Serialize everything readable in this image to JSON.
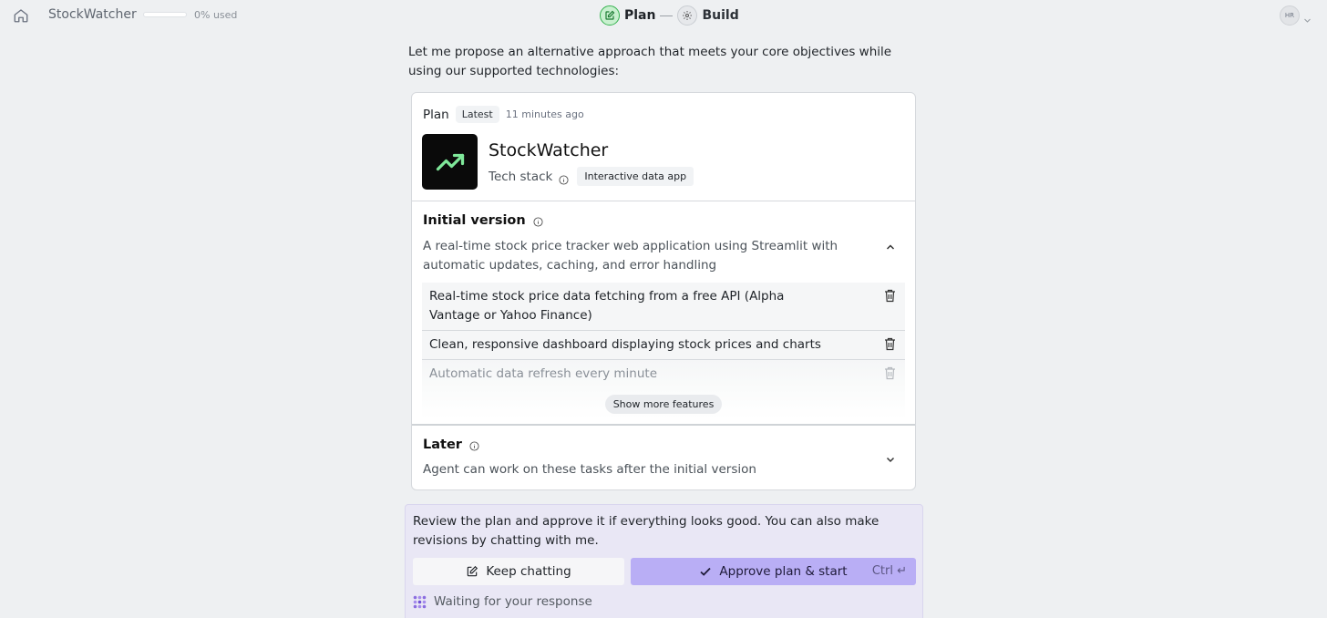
{
  "header": {
    "app_title": "StockWatcher",
    "usage_text": "0% used",
    "usage_fraction": 0,
    "steps": [
      {
        "label": "Plan",
        "state": "active",
        "icon": "edit-icon"
      },
      {
        "label": "Build",
        "state": "inactive",
        "icon": "gear-icon"
      }
    ],
    "avatar_initials": "HR"
  },
  "intro_text": "Let me propose an alternative approach that meets your core objectives while using our supported technologies:",
  "plan": {
    "label": "Plan",
    "badge": "Latest",
    "time": "11 minutes ago",
    "project_name": "StockWatcher",
    "logo_icon": "trending-up-icon",
    "logo_color": "#7fe89a",
    "tech_stack_label": "Tech stack",
    "tech_stack_value": "Interactive data app",
    "initial_version": {
      "title": "Initial version",
      "description": "A real-time stock price tracker web application using Streamlit with automatic updates, caching, and error handling",
      "features": [
        "Real-time stock price data fetching from a free API (Alpha Vantage or Yahoo Finance)",
        "Clean, responsive dashboard displaying stock prices and charts",
        "Automatic data refresh every minute"
      ],
      "show_more_label": "Show more features"
    },
    "later": {
      "title": "Later",
      "description": "Agent can work on these tasks after the initial version"
    }
  },
  "review": {
    "text": "Review the plan and approve it if everything looks good. You can also make revisions by chatting with me.",
    "keep_chatting_label": "Keep chatting",
    "approve_label": "Approve plan & start",
    "shortcut": "Ctrl ↵",
    "waiting_text": "Waiting for your response"
  },
  "colors": {
    "background": "#eef0f2",
    "plan_step_accent": "#35b24f",
    "approve_button": "#b9aef5",
    "review_panel": "#e9e7f5"
  }
}
